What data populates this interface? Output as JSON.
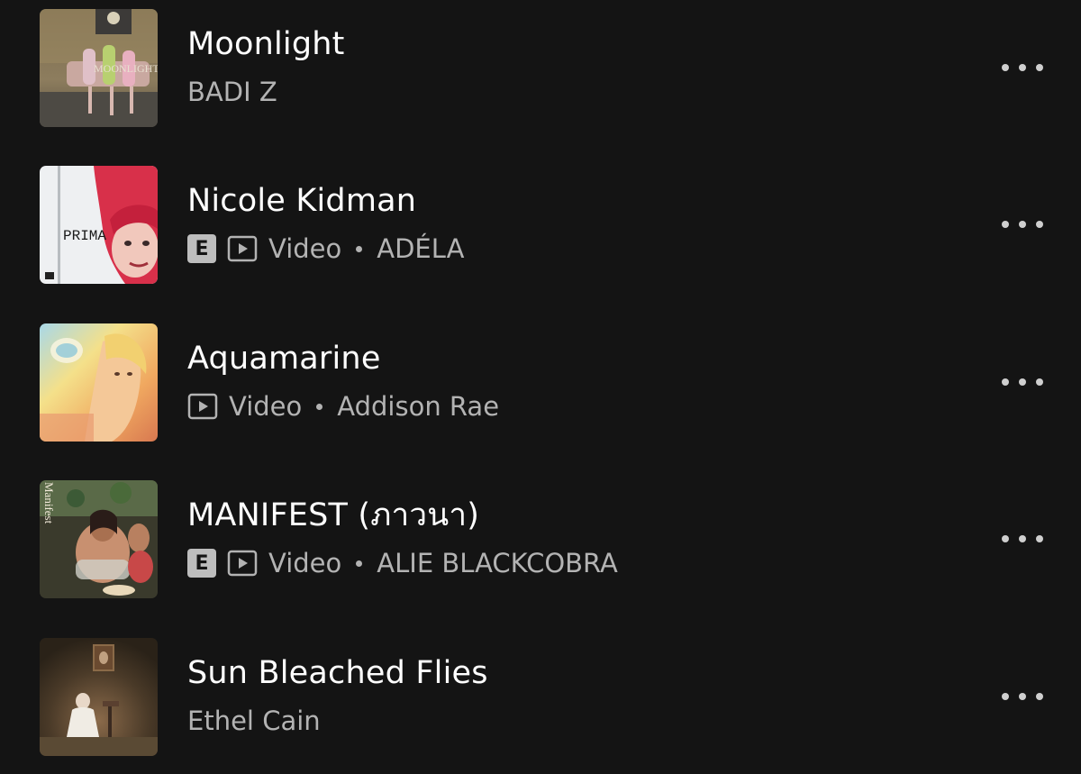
{
  "tracks": [
    {
      "title": "Moonlight",
      "explicit": false,
      "video": false,
      "video_label": "",
      "artist": "BADI Z",
      "cover_text": ""
    },
    {
      "title": "Nicole Kidman",
      "explicit": true,
      "explicit_label": "E",
      "video": true,
      "video_label": "Video",
      "artist": "ADÉLA",
      "cover_text": "PRIMA"
    },
    {
      "title": "Aquamarine",
      "explicit": false,
      "video": true,
      "video_label": "Video",
      "artist": "Addison Rae",
      "cover_text": ""
    },
    {
      "title": "MANIFEST (ภาวนา)",
      "explicit": true,
      "explicit_label": "E",
      "video": true,
      "video_label": "Video",
      "artist": "ALIE BLACKCOBRA",
      "cover_text": "Manifest"
    },
    {
      "title": "Sun Bleached Flies",
      "explicit": false,
      "video": false,
      "video_label": "",
      "artist": "Ethel Cain",
      "cover_text": ""
    }
  ],
  "colors": {
    "background": "#141414",
    "title": "#ffffff",
    "subtitle": "#b3b3b3",
    "more_dots": "#cfcfcf"
  },
  "icons": {
    "more": "more-horizontal-icon",
    "video": "video-play-icon",
    "explicit": "explicit-badge-icon"
  }
}
